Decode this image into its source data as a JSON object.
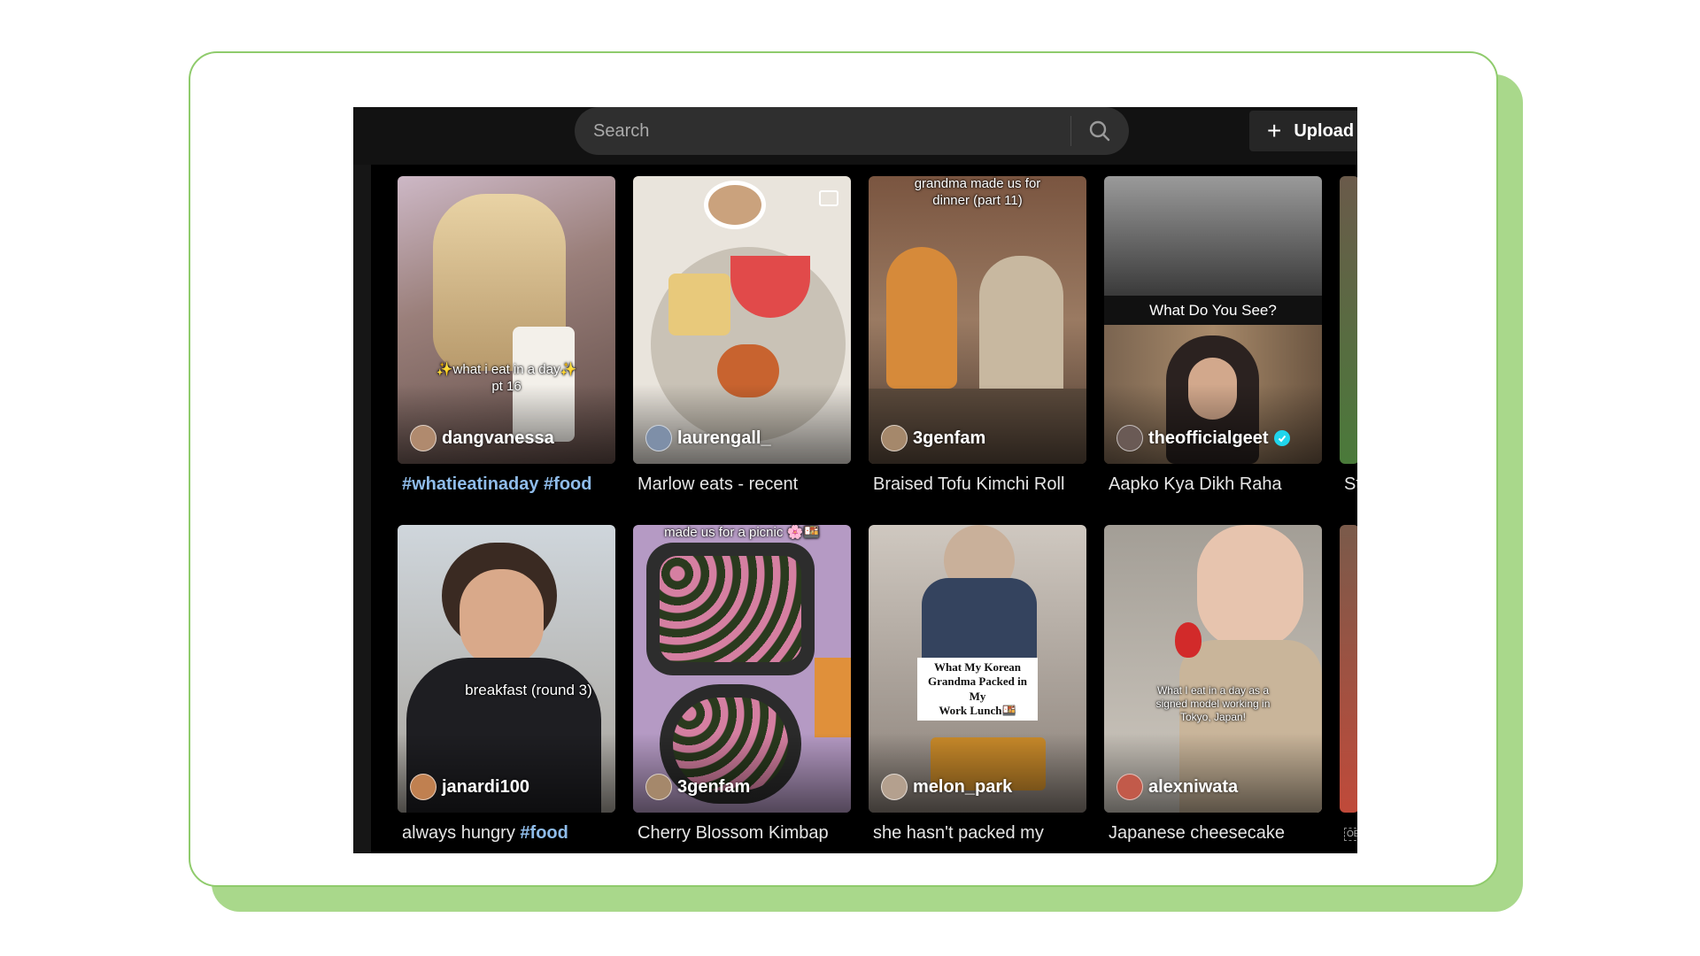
{
  "search": {
    "placeholder": "Search"
  },
  "upload": {
    "label": "Upload"
  },
  "videos": [
    {
      "user": "dangvanessa",
      "overlay": "✨what i eat in a day✨\npt 16",
      "caption_tags": "#whatieatinaday #food",
      "caption": ""
    },
    {
      "user": "laurengall_",
      "overlay": "",
      "caption": "Marlow eats - recent"
    },
    {
      "user": "3genfam",
      "overlay": "grandma made us for\ndinner (part 11)",
      "caption": "Braised Tofu Kimchi Roll"
    },
    {
      "user": "theofficialgeet",
      "overlay": "What Do You See?",
      "caption": "Aapko Kya Dikh Raha"
    },
    {
      "caption": "St"
    },
    {
      "user": "janardi100",
      "overlay": "breakfast (round 3)",
      "caption": "always hungry ",
      "caption_tags": "#food"
    },
    {
      "user": "3genfam",
      "overlay": "made us for a picnic 🌸🍱",
      "caption": "Cherry Blossom Kimbap"
    },
    {
      "user": "melon_park",
      "overlay": "What My Korean\nGrandma Packed in My\nWork Lunch🍱",
      "caption": "she hasn't packed my"
    },
    {
      "user": "alexniwata",
      "overlay": "What I eat in a day as a\nsigned model working in\nTokyo, Japan!",
      "caption": "Japanese cheesecake"
    },
    {
      "badge": "OBJ"
    }
  ],
  "colors": {
    "accent_tag": "#8fbcea",
    "verified": "#20d5ec",
    "frame_green": "#a9d88b"
  }
}
